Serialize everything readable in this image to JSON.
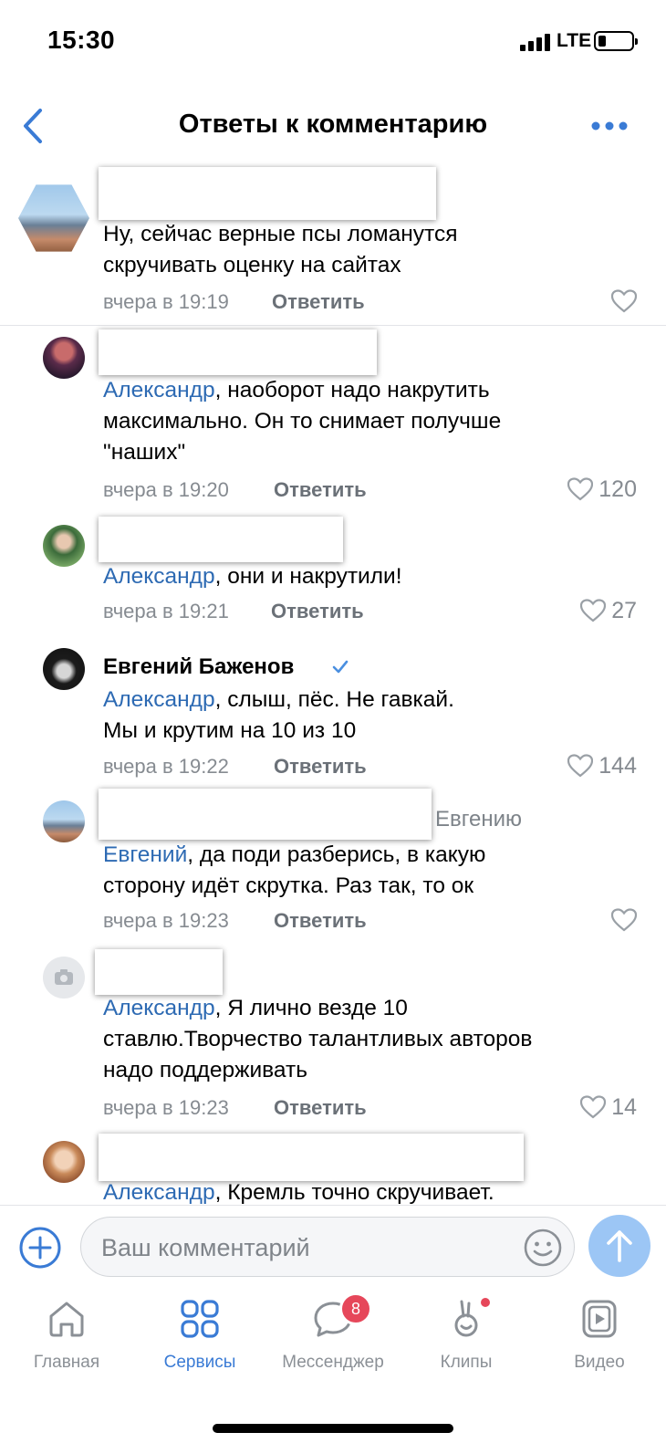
{
  "status_bar": {
    "time": "15:30",
    "network": "LTE"
  },
  "header": {
    "title": "Ответы к комментарию"
  },
  "comments": [
    {
      "author": "",
      "addressee": "",
      "mention": "",
      "text_lines": [
        "Ну, сейчас верные псы ломанутся",
        "скручивать оценку на сайтах"
      ],
      "time": "вчера в 19:19",
      "reply_label": "Ответить",
      "likes": ""
    },
    {
      "author": "",
      "addressee": "",
      "mention": "Александр",
      "text_lines": [
        ", наоборот надо накрутить",
        "максимально. Он то снимает получше",
        "\"наших\""
      ],
      "time": "вчера в 19:20",
      "reply_label": "Ответить",
      "likes": "120"
    },
    {
      "author": "",
      "addressee": "",
      "mention": "Александр",
      "text_lines": [
        ", они и накрутили!"
      ],
      "time": "вчера в 19:21",
      "reply_label": "Ответить",
      "likes": "27"
    },
    {
      "author": "Евгений Баженов",
      "addressee": "",
      "mention": "Александр",
      "text_lines": [
        ", слыш, пёс. Не гавкай.",
        "Мы и крутим на 10 из 10"
      ],
      "time": "вчера в 19:22",
      "reply_label": "Ответить",
      "likes": "144"
    },
    {
      "author": "",
      "addressee": "Евгению",
      "mention": "Евгений",
      "text_lines": [
        ", да поди разберись, в какую",
        "сторону идёт скрутка. Раз так, то ок"
      ],
      "time": "вчера в 19:23",
      "reply_label": "Ответить",
      "likes": ""
    },
    {
      "author": "",
      "addressee": "",
      "mention": "Александр",
      "text_lines": [
        ", Я лично везде 10",
        "ставлю.Творчество талантливых авторов",
        "надо поддерживать"
      ],
      "time": "вчера в 19:23",
      "reply_label": "Ответить",
      "likes": "14"
    },
    {
      "author": "",
      "addressee": "",
      "mention": "Александр",
      "text_lines": [
        ", Кремль точно скручивает."
      ],
      "time": "",
      "reply_label": "",
      "likes": ""
    }
  ],
  "composer": {
    "placeholder": "Ваш комментарий"
  },
  "tabs": [
    {
      "label": "Главная",
      "icon": "home-icon",
      "active": false
    },
    {
      "label": "Сервисы",
      "icon": "services-icon",
      "active": true
    },
    {
      "label": "Мессенджер",
      "icon": "messenger-icon",
      "active": false,
      "badge": "8"
    },
    {
      "label": "Клипы",
      "icon": "clips-icon",
      "active": false
    },
    {
      "label": "Видео",
      "icon": "video-icon",
      "active": false
    }
  ],
  "colors": {
    "accent": "#3a7bd5",
    "mention": "#2d6ab3",
    "badge": "#e6475a",
    "send": "#9cc6f5"
  }
}
